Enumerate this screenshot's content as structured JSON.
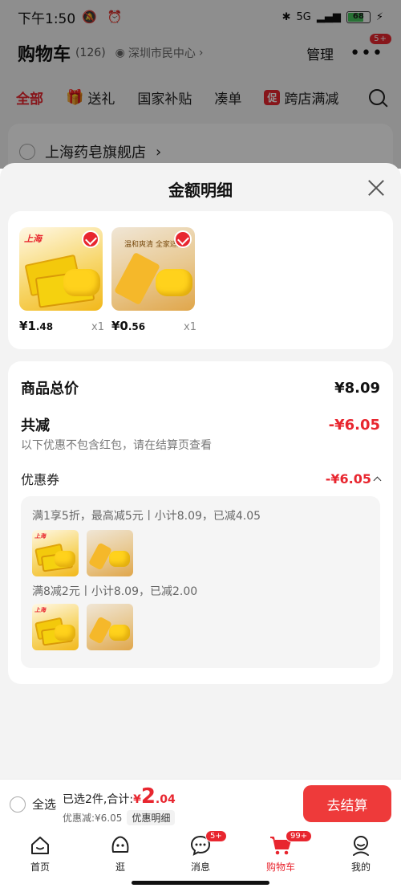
{
  "status_bar": {
    "time": "下午1:50",
    "left_icons": "🔕 ⏰",
    "network": "5G",
    "battery": "68"
  },
  "cart_header": {
    "title": "购物车",
    "count": "(126)",
    "location": "深圳市民中心",
    "manage": "管理",
    "more_badge": "5+"
  },
  "filter_tabs": [
    {
      "label": "全部"
    },
    {
      "label": "送礼"
    },
    {
      "label": "国家补贴"
    },
    {
      "label": "凑单"
    },
    {
      "label": "跨店满减",
      "icon_text": "促"
    }
  ],
  "store": {
    "name": "上海药皂旗舰店",
    "chevron": "›"
  },
  "sheet": {
    "title": "金额明细",
    "products": [
      {
        "price_int": "¥1",
        "price_dec": ".48",
        "qty": "x1",
        "brand": "上海"
      },
      {
        "price_int": "¥0",
        "price_dec": ".56",
        "qty": "x1",
        "banner": "温和爽清 全家适用"
      }
    ],
    "goods_total_label": "商品总价",
    "goods_total_value": "¥8.09",
    "total_discount_label": "共减",
    "total_discount_value": "-¥6.05",
    "discount_note": "以下优惠不包含红包，请在结算页查看",
    "coupon_label": "优惠券",
    "coupon_value": "-¥6.05",
    "coupon_rules": [
      {
        "text": "满1享5折，最高减5元丨小计8.09，已减4.05"
      },
      {
        "text": "满8减2元丨小计8.09，已减2.00"
      }
    ]
  },
  "checkout": {
    "select_all": "全选",
    "selected_text": "已选2件,合计:",
    "total_symbol": "¥",
    "total_int": "2",
    "total_dec": ".04",
    "discount_text": "优惠减:¥6.05",
    "detail_chip": "优惠明细",
    "button": "去结算"
  },
  "tab_bar": [
    {
      "label": "首页",
      "icon": "home-icon"
    },
    {
      "label": "逛",
      "icon": "browse-icon"
    },
    {
      "label": "消息",
      "icon": "message-icon",
      "badge": "5+"
    },
    {
      "label": "购物车",
      "icon": "cart-icon",
      "badge": "99+"
    },
    {
      "label": "我的",
      "icon": "profile-icon"
    }
  ],
  "colors": {
    "accent": "#e8262f",
    "button": "#ee3a3a",
    "sheet_bg": "#f3f3f3"
  }
}
